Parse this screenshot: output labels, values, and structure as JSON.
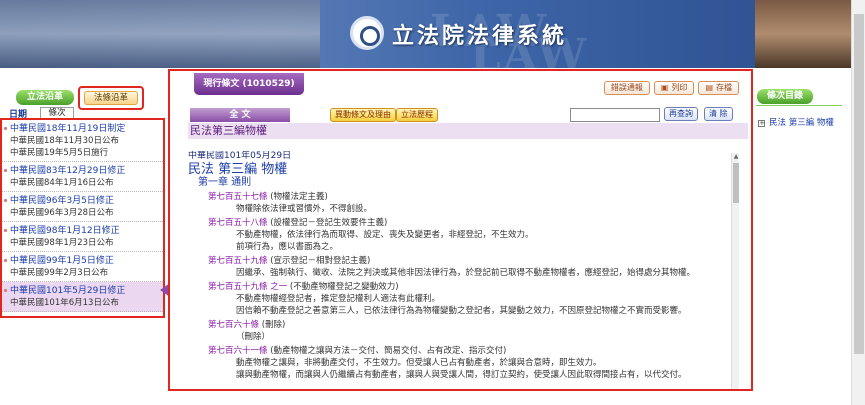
{
  "banner": {
    "site_title": "立法院法律系統",
    "background_text": "LAW"
  },
  "left_panel": {
    "tab_legislative": "立法沿革",
    "tab_article": "法條沿革",
    "subtab_date": "日期",
    "subtab_count": "條次",
    "history": [
      {
        "title": "中華民國18年11月19日制定",
        "sub": [
          "中華民國18年11月30日公布",
          "中華民國19年5月5日施行"
        ]
      },
      {
        "title": "中華民國83年12月29日修正",
        "sub": [
          "中華民國84年1月16日公布"
        ]
      },
      {
        "title": "中華民國96年3月5日修正",
        "sub": [
          "中華民國96年3月28日公布"
        ]
      },
      {
        "title": "中華民國98年1月12日修正",
        "sub": [
          "中華民國98年1月23日公布"
        ]
      },
      {
        "title": "中華民國99年1月5日修正",
        "sub": [
          "中華民國99年2月3日公布"
        ]
      },
      {
        "title": "中華民國101年5月29日修正",
        "sub": [
          "中華民國101年6月13日公布"
        ],
        "active": true
      }
    ]
  },
  "main": {
    "version_tab": "現行條文 (1010529)",
    "tools": {
      "error_report": "錯誤通報",
      "print": "列印",
      "save": "存檔"
    },
    "fulltext": "全 文",
    "diff_btn": "異動條文及理由",
    "history_btn": "立法歷程",
    "search_placeholder": "",
    "search_btn": "再查詢",
    "clear_btn": "清 除",
    "chapter_bar": "民法第三編物權",
    "law_date": "中華民國101年05月29日",
    "law_name": "民法 第三編 物權",
    "chapter": "第一章 通則",
    "articles": [
      {
        "num": "第七百五十七條",
        "title": "(物權法定主義)",
        "body": [
          "物權除依法律或習慣外，不得創設。"
        ]
      },
      {
        "num": "第七百五十八條",
        "title": "(設權登記－登記生效要件主義)",
        "body": [
          "不動產物權，依法律行為而取得、設定、喪失及變更者，非經登記，不生效力。",
          "前項行為，應以書面為之。"
        ]
      },
      {
        "num": "第七百五十九條",
        "title": "(宣示登記－相對登記主義)",
        "body": [
          "因繼承、強制執行、徵收、法院之判決或其他非因法律行為，於登記前已取得不動產物權者，應經登記，始得處分其物權。"
        ]
      },
      {
        "num": "第七百五十九條 之一",
        "title": "(不動產物權登記之變動效力)",
        "body": [
          "不動產物權經登記者，推定登記權利人適法有此權利。",
          "因信賴不動產登記之善意第三人，已依法律行為為物權變動之登記者，其變動之效力，不因原登記物權之不實而受影響。"
        ]
      },
      {
        "num": "第七百六十條",
        "title": "(刪除)",
        "body": [
          "（刪除）"
        ]
      },
      {
        "num": "第七百六十一條",
        "title": "(動產物權之讓與方法－交付、簡易交付、占有改定、指示交付)",
        "body": [
          "動產物權之讓與，非將動產交付，不生效力。但受讓人已占有動產者，於讓與合意時，即生效力。",
          "讓與動產物權，而讓與人仍繼續占有動產者，讓與人與受讓人間，得訂立契約，使受讓人因此取得間接占有，以代交付。"
        ]
      }
    ]
  },
  "toc": {
    "tab": "條次目錄",
    "item": "民法 第三編 物權"
  }
}
